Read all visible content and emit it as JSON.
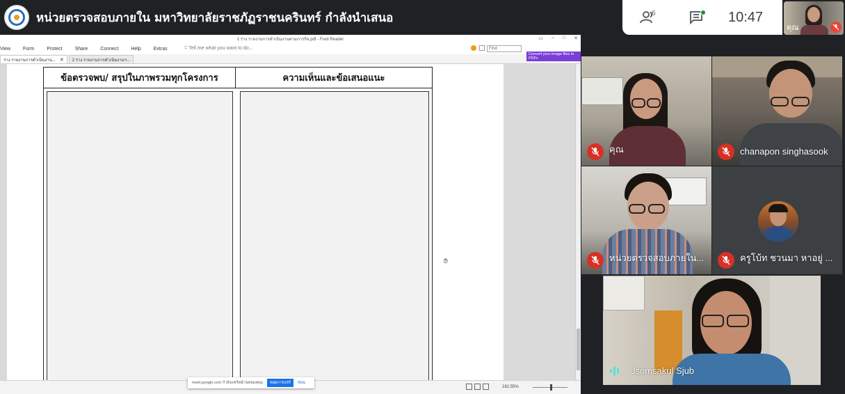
{
  "presenter": {
    "title": "หน่วยตรวจสอบภายใน มหาวิทยาลัยราชภัฏราชนครินทร์ กำลังนำเสนอ"
  },
  "controls": {
    "people_count": "6",
    "clock": "10:47",
    "self_label": "คุณ"
  },
  "foxit": {
    "window_title": "1  ร่าง รายงานการดำเนินงานตามภารกิจ.pdf - Foxit Reader",
    "menu": [
      "View",
      "Form",
      "Protect",
      "Share",
      "Connect",
      "Help",
      "Extras"
    ],
    "tell_me": "Tell me what you want to do...",
    "find_placeholder": "Find",
    "convert_banner": "Convert your image files to PDFs",
    "tabs": [
      {
        "label": "ร่าง รายงานการดำเนินงาน..."
      },
      {
        "label": "2  ร่าง รายงานการดำเนินงานฯ..."
      }
    ],
    "zoom_level": "182.55%"
  },
  "document": {
    "col1_header": "ข้อตรวจพบ/ สรุปในภาพรวมทุกโครงการ",
    "col2_header": "ความเห็นและข้อเสนอแนะ"
  },
  "share_notice": {
    "text": "meet.google.com กำลังแชร์หน้าจอของคุณ",
    "stop_label": "หยุดการแชร์",
    "hide_label": "ซ่อน"
  },
  "participants": [
    {
      "name": "คุณ",
      "muted": true
    },
    {
      "name": "chanapon singhasook",
      "muted": true
    },
    {
      "name": "หน่วยตรวจสอบภายใน...",
      "muted": true
    },
    {
      "name": "ครูโบ้ท ชวนมา หาอยู่ ...",
      "muted": true
    },
    {
      "name": "Jsomsakul Sjub",
      "muted": false,
      "speaking": true
    }
  ],
  "colors": {
    "meet_bg": "#202124",
    "mute_red": "#d93025",
    "speaking_teal": "#5ee0d6",
    "banner_purple": "#7a3dd8"
  }
}
